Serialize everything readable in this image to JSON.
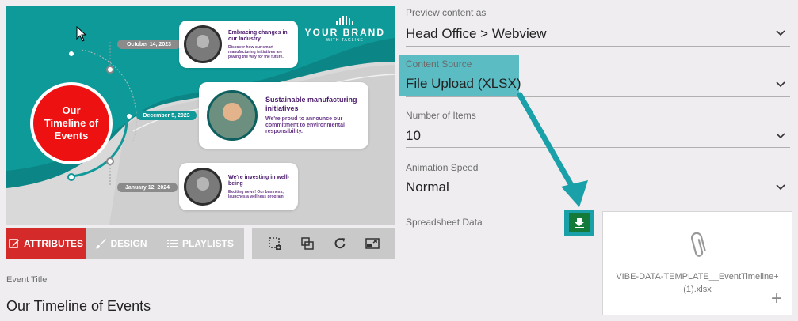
{
  "preview": {
    "brand_name": "YOUR BRAND",
    "brand_tagline": "WITH TAGLINE",
    "circle_title": "Our Timeline of Events",
    "events": [
      {
        "date": "October 14, 2023",
        "title": "Embracing changes in our Industry",
        "body": "Discover how our smart manufacturing initiatives are paving the way for the future."
      },
      {
        "date": "December 5, 2023",
        "title": "Sustainable manufacturing initiatives",
        "body": "We're proud to announce our commitment to environmental responsibility."
      },
      {
        "date": "January 12, 2024",
        "title": "We're investing in well-being",
        "body": "Exciting news! Our business, launches a wellness program."
      }
    ]
  },
  "tabs": {
    "attributes": "ATTRIBUTES",
    "design": "DESIGN",
    "playlists": "PLAYLISTS"
  },
  "event_title": {
    "label": "Event Title",
    "value": "Our Timeline of Events"
  },
  "form": {
    "preview_content": {
      "label": "Preview content as",
      "value": "Head Office > Webview"
    },
    "content_source": {
      "label": "Content Source",
      "value": "File Upload (XLSX)"
    },
    "number_of_items": {
      "label": "Number of Items",
      "value": "10"
    },
    "animation_speed": {
      "label": "Animation Speed",
      "value": "Normal"
    },
    "spreadsheet": {
      "label": "Spreadsheet Data",
      "file_name": "VIBE-DATA-TEMPLATE__EventTimeline+(1).xlsx",
      "plus": "+"
    }
  },
  "colors": {
    "teal": "#119999",
    "red": "#d42a2a",
    "highlight": "#5bbcc4",
    "download_green": "#137a3a"
  },
  "icons": [
    "cursor-icon",
    "edit-icon",
    "brush-icon",
    "list-icon",
    "crop-screenshot-icon",
    "layers-icon",
    "refresh-icon",
    "resize-icon",
    "chevron-down-icon",
    "download-icon",
    "paperclip-icon",
    "plus-icon",
    "arrow-annotation"
  ]
}
